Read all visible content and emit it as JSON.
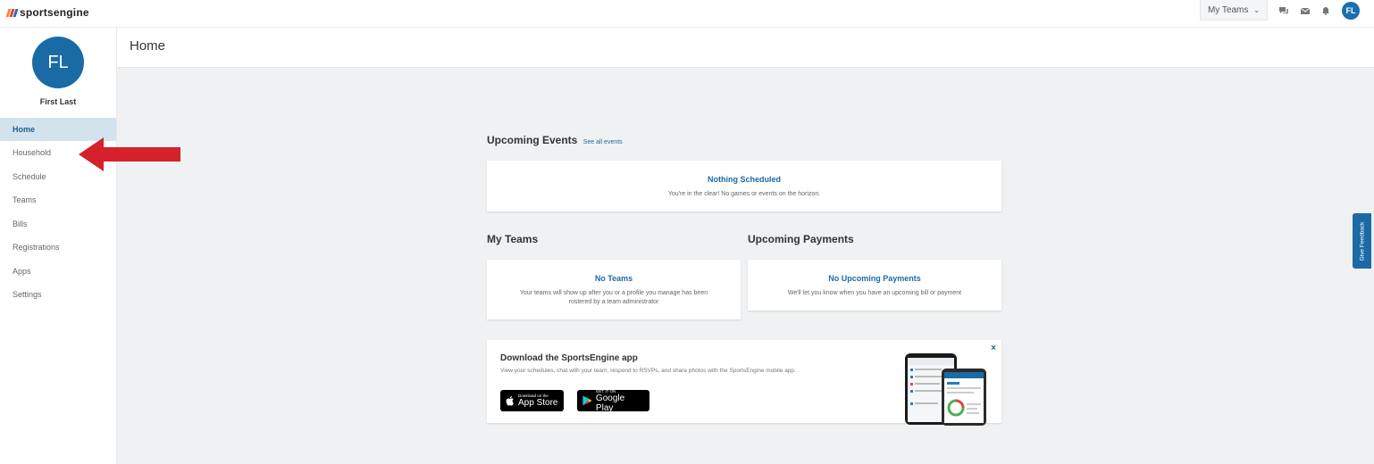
{
  "topbar": {
    "logo_text": "sportsengine",
    "my_teams_label": "My Teams",
    "avatar_initials": "FL"
  },
  "sidebar": {
    "avatar_initials": "FL",
    "user_name": "First Last",
    "items": [
      {
        "label": "Home",
        "active": true
      },
      {
        "label": "Household"
      },
      {
        "label": "Schedule"
      },
      {
        "label": "Teams"
      },
      {
        "label": "Bills"
      },
      {
        "label": "Registrations"
      },
      {
        "label": "Apps"
      },
      {
        "label": "Settings"
      }
    ]
  },
  "page": {
    "title": "Home"
  },
  "upcoming_events": {
    "title": "Upcoming Events",
    "see_all": "See all events",
    "empty_title": "Nothing Scheduled",
    "empty_text": "You're in the clear! No games or events on the horizon."
  },
  "my_teams": {
    "title": "My Teams",
    "empty_title": "No Teams",
    "empty_text_line1": "Your teams will show up after you or a profile you manage has been",
    "empty_text_line2": "rostered by a team administrator"
  },
  "upcoming_payments": {
    "title": "Upcoming Payments",
    "empty_title": "No Upcoming Payments",
    "empty_text": "We'll let you know when you have an upcoming bill or payment"
  },
  "app_promo": {
    "title": "Download the SportsEngine app",
    "description": "View your schedules, chat with your team, respond to RSVPs, and share photos with the SportsEngine mobile app.",
    "app_store_small": "Download on the",
    "app_store_big": "App Store",
    "google_play_small": "GET IT ON",
    "google_play_big": "Google Play",
    "close": "×"
  },
  "feedback": {
    "label": "Give Feedback"
  },
  "colors": {
    "brand_blue": "#1b6aa5",
    "active_nav_bg": "#d3e3ee",
    "arrow_red": "#d4212b",
    "logo_orange": "#f28c28",
    "logo_red": "#e23b3b",
    "logo_blue": "#2b6cb0"
  },
  "icons": [
    "chat-icon",
    "mail-icon",
    "bell-icon",
    "chevron-down-icon",
    "apple-icon",
    "google-play-icon",
    "close-icon"
  ]
}
